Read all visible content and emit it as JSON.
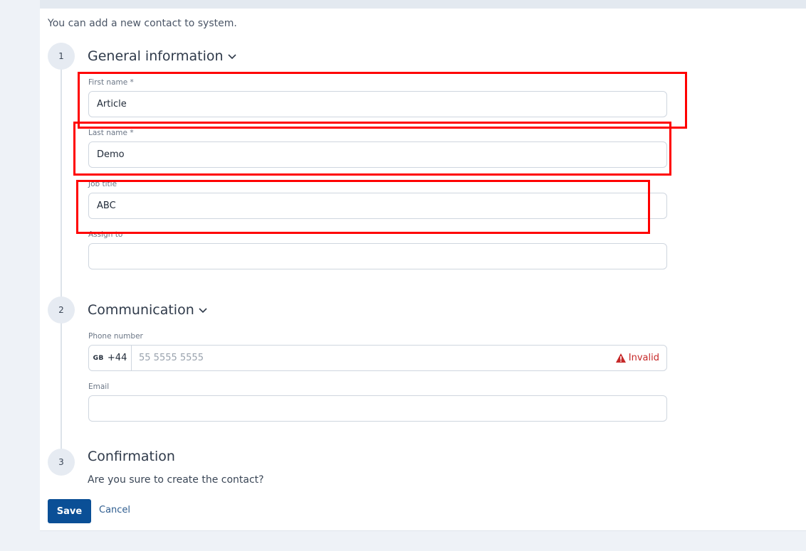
{
  "intro": "You can add a new contact to system.",
  "steps": [
    {
      "number": "1",
      "title": "General information"
    },
    {
      "number": "2",
      "title": "Communication"
    },
    {
      "number": "3",
      "title": "Confirmation"
    }
  ],
  "general": {
    "first_name": {
      "label": "First name *",
      "value": "Article"
    },
    "last_name": {
      "label": "Last name *",
      "value": "Demo"
    },
    "job_title": {
      "label": "Job title",
      "value": "ABC"
    },
    "assign_to": {
      "label": "Assign to",
      "value": ""
    }
  },
  "communication": {
    "phone": {
      "label": "Phone number",
      "country_code": "GB",
      "dial_code": "+44",
      "placeholder": "55 5555 5555",
      "status": "Invalid"
    },
    "email": {
      "label": "Email",
      "value": ""
    }
  },
  "confirmation": {
    "text": "Are you sure to create the contact?"
  },
  "actions": {
    "save_label": "Save",
    "cancel_label": "Cancel"
  },
  "colors": {
    "primary": "#0a4f96",
    "error": "#c62828",
    "annotation": "#ff0000"
  }
}
